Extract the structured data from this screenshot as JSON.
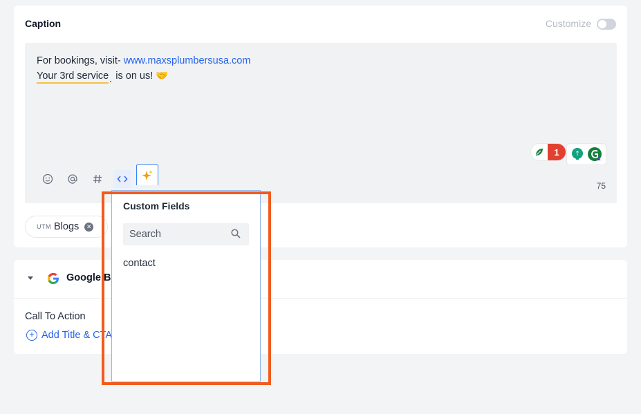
{
  "caption": {
    "title": "Caption",
    "customize_label": "Customize",
    "customize_on": false,
    "line1_prefix": "For bookings, visit- ",
    "line1_link": "www.maxsplumbersusa.com",
    "line2_underlined": "Your 3rd service",
    "line2_rest": " is on us! ",
    "line2_emoji": "🤝",
    "char_count": "75",
    "toolbar": [
      "emoji-icon",
      "mention-icon",
      "hashtag-icon",
      "code-icon",
      "ai-sparkle-icon"
    ],
    "grammar_badge_count": "1"
  },
  "tag_chip": {
    "prefix": "UTM",
    "label": "Blogs"
  },
  "google_section": {
    "title": "Google Bu",
    "cta_label": "Call To Action",
    "add_cta": "Add Title & CTA"
  },
  "custom_fields": {
    "title": "Custom Fields",
    "search_placeholder": "Search",
    "items": [
      "contact"
    ]
  },
  "colors": {
    "link": "#2563eb",
    "highlight": "#f25a1d",
    "badge": "#e2412f"
  }
}
